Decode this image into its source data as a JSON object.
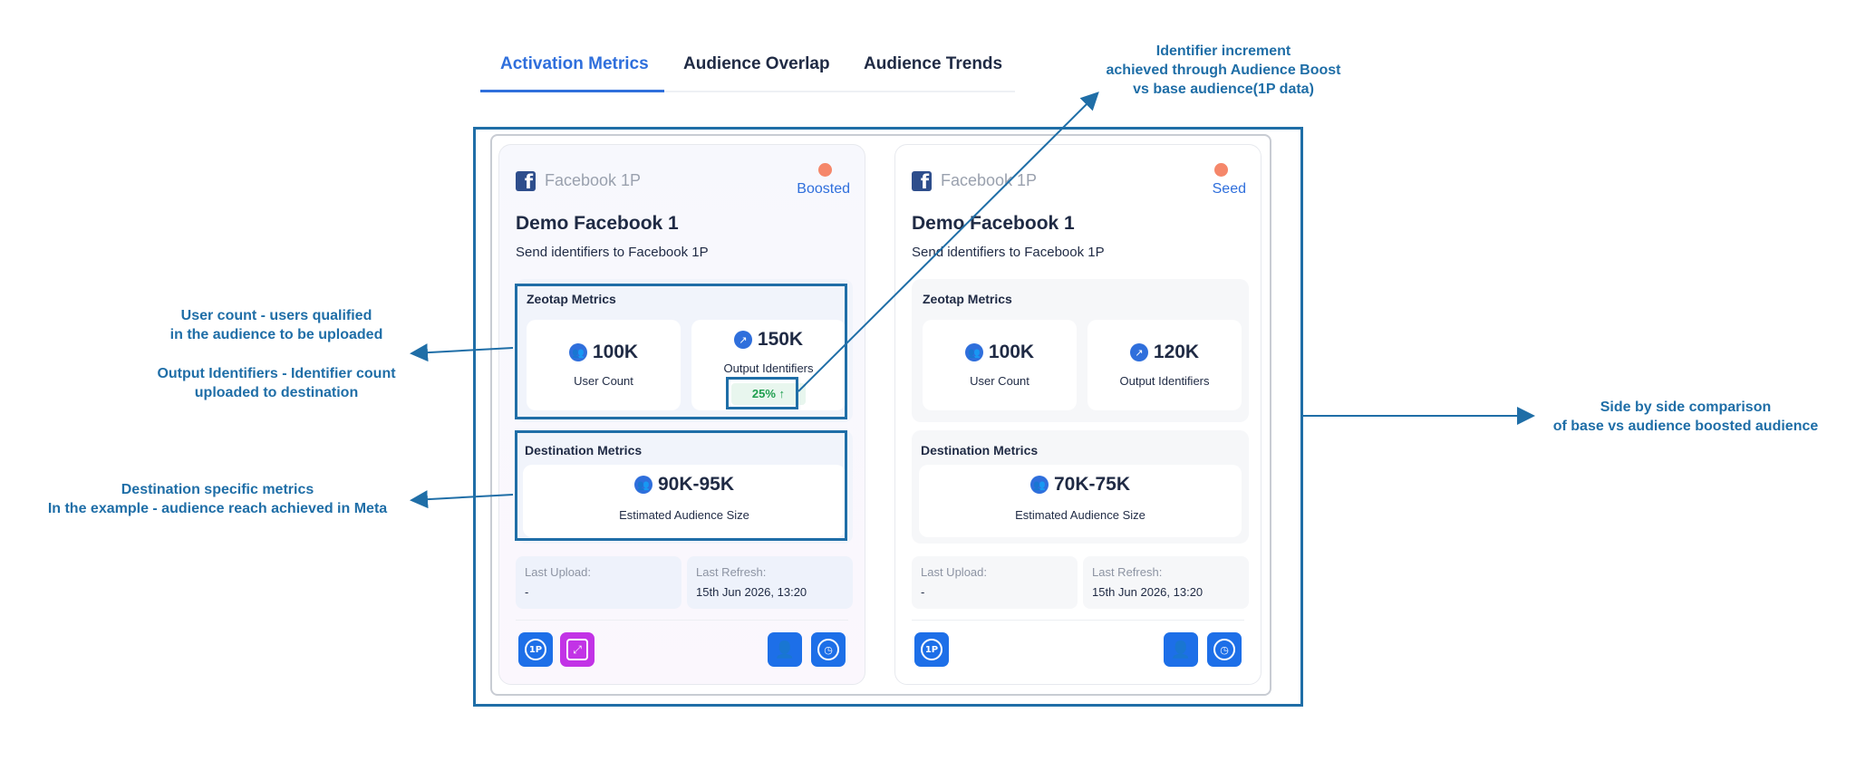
{
  "tabs": [
    {
      "label": "Activation Metrics",
      "active": true
    },
    {
      "label": "Audience Overlap",
      "active": false
    },
    {
      "label": "Audience Trends",
      "active": false
    }
  ],
  "cards": {
    "left": {
      "platform": "Facebook 1P",
      "status": "Boosted",
      "status_color": "#f5876a",
      "title": "Demo Facebook 1",
      "subtitle": "Send identifiers to Facebook 1P",
      "zeotap_title": "Zeotap Metrics",
      "user_count": "100K",
      "user_count_label": "User Count",
      "output_identifiers": "150K",
      "output_identifiers_label": "Output Identifiers",
      "increment": "25% ↑",
      "destination_title": "Destination Metrics",
      "audience_size": "90K-95K",
      "audience_size_label": "Estimated Audience Size",
      "last_upload_label": "Last Upload:",
      "last_upload": "-",
      "last_refresh_label": "Last Refresh:",
      "last_refresh": "15th Jun 2026, 13:20",
      "badge_1p": "1P"
    },
    "right": {
      "platform": "Facebook 1P",
      "status": "Seed",
      "status_color": "#f5876a",
      "title": "Demo Facebook 1",
      "subtitle": "Send identifiers to Facebook 1P",
      "zeotap_title": "Zeotap Metrics",
      "user_count": "100K",
      "user_count_label": "User Count",
      "output_identifiers": "120K",
      "output_identifiers_label": "Output Identifiers",
      "destination_title": "Destination Metrics",
      "audience_size": "70K-75K",
      "audience_size_label": "Estimated Audience Size",
      "last_upload_label": "Last Upload:",
      "last_upload": "-",
      "last_refresh_label": "Last Refresh:",
      "last_refresh": "15th Jun 2026, 13:20",
      "badge_1p": "1P"
    }
  },
  "annotations": {
    "identifier_increment": [
      "Identifier increment",
      "achieved through Audience Boost",
      "vs base audience(1P data)"
    ],
    "user_count": [
      "User count - users qualified",
      "in the audience to be uploaded"
    ],
    "output_identifiers": [
      "Output Identifiers - Identifier count",
      "uploaded to destination"
    ],
    "destination": [
      "Destination specific metrics",
      "In the example - audience reach achieved in Meta"
    ],
    "side_by_side": [
      "Side by side comparison",
      "of base vs audience boosted audience"
    ]
  },
  "colors": {
    "accent": "#2f6fdc",
    "annotation": "#1f6ea7",
    "increment_green": "#1e9e4e",
    "boost_purple": "#c233e6"
  },
  "icons": [
    "facebook-icon",
    "users-icon",
    "export-icon",
    "1p-badge-icon",
    "boost-expand-icon",
    "remove-user-icon",
    "clock-icon",
    "arrow-up-icon"
  ]
}
